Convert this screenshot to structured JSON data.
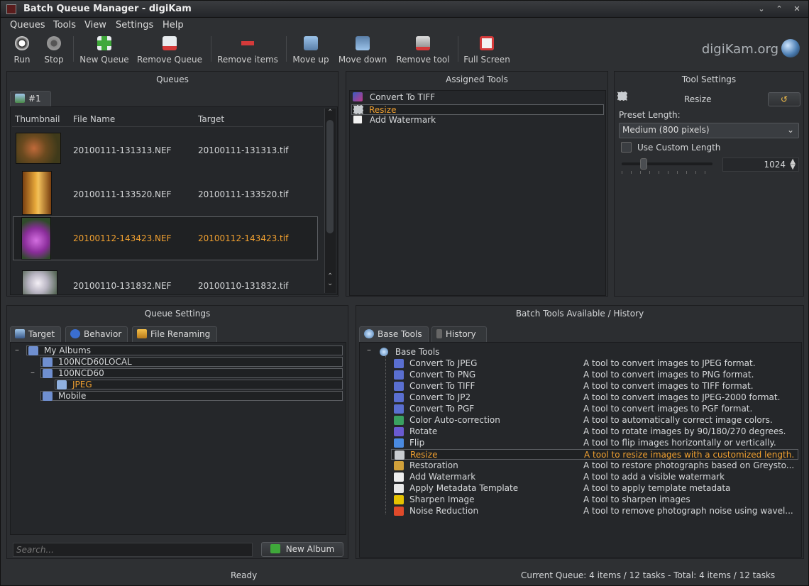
{
  "window": {
    "title": "Batch Queue Manager - digiKam",
    "min_glyph": "⌄",
    "max_glyph": "⌃",
    "close_glyph": "✕"
  },
  "menu": {
    "queues": "Queues",
    "tools": "Tools",
    "view": "View",
    "settings": "Settings",
    "help": "Help"
  },
  "toolbar": {
    "run": "Run",
    "stop": "Stop",
    "new_queue": "New Queue",
    "remove_queue": "Remove Queue",
    "remove_items": "Remove items",
    "move_up": "Move up",
    "move_down": "Move down",
    "remove_tool": "Remove tool",
    "full_screen": "Full Screen",
    "logo": "digiKam.org"
  },
  "queues_panel": {
    "title": "Queues",
    "tab": "#1",
    "columns": {
      "thumbnail": "Thumbnail",
      "file_name": "File Name",
      "target": "Target"
    },
    "rows": [
      {
        "file": "20100111-131313.NEF",
        "target": "20100111-131313.tif"
      },
      {
        "file": "20100111-133520.NEF",
        "target": "20100111-133520.tif"
      },
      {
        "file": "20100112-143423.NEF",
        "target": "20100112-143423.tif"
      },
      {
        "file": "20100110-131832.NEF",
        "target": "20100110-131832.tif"
      }
    ]
  },
  "assigned_tools": {
    "title": "Assigned Tools",
    "items": [
      "Convert To TIFF",
      "Resize",
      "Add Watermark"
    ]
  },
  "tool_settings": {
    "title": "Tool Settings",
    "tool_name": "Resize",
    "preset_label": "Preset Length:",
    "preset_value": "Medium (800 pixels)",
    "custom_label": "Use Custom Length",
    "custom_value": "1024"
  },
  "queue_settings": {
    "title": "Queue Settings",
    "tabs": {
      "target": "Target",
      "behavior": "Behavior",
      "file_renaming": "File Renaming"
    },
    "tree": [
      "My Albums",
      "100NCD60LOCAL",
      "100NCD60",
      "JPEG",
      "Mobile"
    ],
    "search_placeholder": "Search...",
    "new_album": "New Album"
  },
  "batch_tools": {
    "title": "Batch Tools Available / History",
    "tabs": {
      "base": "Base Tools",
      "history": "History"
    },
    "root": "Base Tools",
    "items": [
      {
        "name": "Convert To JPEG",
        "desc": "A tool to convert images to JPEG format."
      },
      {
        "name": "Convert To PNG",
        "desc": "A tool to convert images to PNG format."
      },
      {
        "name": "Convert To TIFF",
        "desc": "A tool to convert images to TIFF format."
      },
      {
        "name": "Convert To JP2",
        "desc": "A tool to convert images to JPEG-2000 format."
      },
      {
        "name": "Convert To PGF",
        "desc": "A tool to convert images to PGF format."
      },
      {
        "name": "Color Auto-correction",
        "desc": "A tool to automatically correct image colors."
      },
      {
        "name": "Rotate",
        "desc": "A tool to rotate images by 90/180/270 degrees."
      },
      {
        "name": "Flip",
        "desc": "A tool to flip images horizontally or vertically."
      },
      {
        "name": "Resize",
        "desc": "A tool to resize images with a customized length."
      },
      {
        "name": "Restoration",
        "desc": "A tool to restore photographs based on Greysto..."
      },
      {
        "name": "Add Watermark",
        "desc": "A tool to add a visible watermark"
      },
      {
        "name": "Apply Metadata Template",
        "desc": "A tool to apply template metadata"
      },
      {
        "name": "Sharpen Image",
        "desc": "A tool to sharpen images"
      },
      {
        "name": "Noise Reduction",
        "desc": "A tool to remove photograph noise using wavel..."
      }
    ]
  },
  "status": {
    "left": "Ready",
    "right": "Current Queue: 4 items / 12 tasks - Total: 4 items / 12 tasks"
  },
  "colors": {
    "highlight": "#f0a030",
    "background": "#2e3033"
  }
}
